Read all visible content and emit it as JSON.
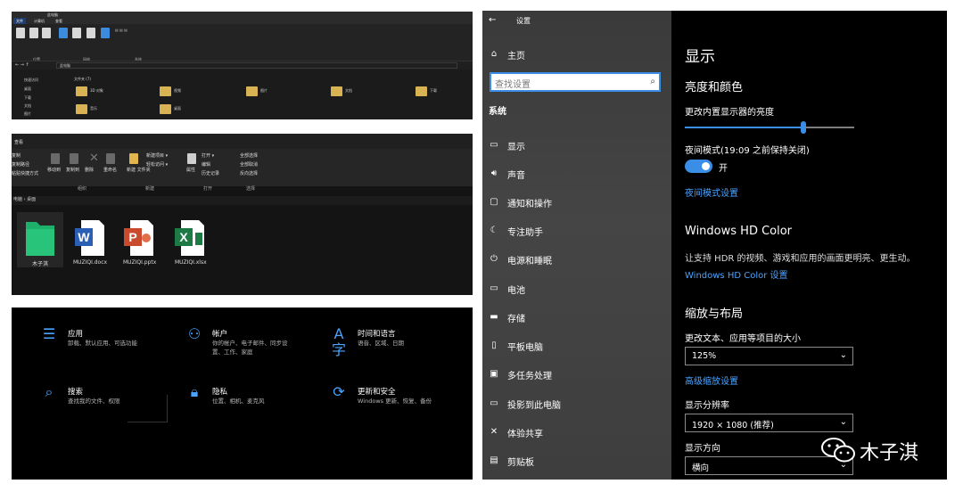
{
  "explorer_top": {
    "title": "此电脑",
    "tabs": [
      "文件",
      "计算机",
      "查看"
    ],
    "ribbon_group_labels": [
      "位置",
      "网络",
      "系统"
    ],
    "address": "此电脑",
    "nav_items": [
      "快速访问",
      "桌面",
      "下载",
      "文档",
      "图片"
    ],
    "folders_header": "文件夹 (7)",
    "folders": [
      "3D 对象",
      "视频",
      "图片",
      "文档",
      "下载",
      "音乐",
      "桌面"
    ]
  },
  "explorer_desktop": {
    "tab": "查看",
    "ribbon": {
      "left_items": [
        "复制",
        "复制路径",
        "粘贴快捷方式"
      ],
      "clipboard_buttons": [
        "移动到",
        "复制到",
        "删除",
        "重命名"
      ],
      "new_items": [
        "新建项目 ▾",
        "轻松访问 ▾"
      ],
      "new_folder": "新建\n文件夹",
      "open_items": [
        "打开 ▾",
        "编辑",
        "历史记录"
      ],
      "properties": "属性",
      "select_items": [
        "全部选择",
        "全部取消",
        "反向选择"
      ],
      "group_labels": [
        "组织",
        "新建",
        "打开",
        "选择"
      ]
    },
    "breadcrumb": "电脑 › 桌面",
    "files": [
      {
        "name": "木子淇",
        "type": "folder"
      },
      {
        "name": "MUZIQI.docx",
        "type": "word"
      },
      {
        "name": "MUZIQI.pptx",
        "type": "ppt"
      },
      {
        "name": "MUZIQI.xlsx",
        "type": "excel"
      }
    ]
  },
  "settings_home": {
    "items": [
      {
        "icon": "apps-icon",
        "title": "应用",
        "desc": [
          "卸载、默认应用、可选功能"
        ]
      },
      {
        "icon": "account-icon",
        "title": "帐户",
        "desc": [
          "你的帐户、电子邮件、同步设",
          "置、工作、家庭"
        ]
      },
      {
        "icon": "time-language-icon",
        "title": "时间和语言",
        "desc": [
          "语音、区域、日期"
        ]
      },
      {
        "icon": "search-icon",
        "title": "搜索",
        "desc": [
          "查找我的文件、权限"
        ]
      },
      {
        "icon": "privacy-lock-icon",
        "title": "隐私",
        "desc": [
          "位置、相机、麦克风"
        ]
      },
      {
        "icon": "update-security-icon",
        "title": "更新和安全",
        "desc": [
          "Windows 更新、恢复、备份"
        ]
      }
    ]
  },
  "settings_display": {
    "window_title": "设置",
    "home": "主页",
    "search_placeholder": "查找设置",
    "section": "系统",
    "nav_items": [
      {
        "icon": "display-icon",
        "label": "显示"
      },
      {
        "icon": "sound-icon",
        "label": "声音"
      },
      {
        "icon": "notifications-icon",
        "label": "通知和操作"
      },
      {
        "icon": "focus-assist-icon",
        "label": "专注助手"
      },
      {
        "icon": "power-icon",
        "label": "电源和睡眠"
      },
      {
        "icon": "battery-icon",
        "label": "电池"
      },
      {
        "icon": "storage-icon",
        "label": "存储"
      },
      {
        "icon": "tablet-icon",
        "label": "平板电脑"
      },
      {
        "icon": "multitasking-icon",
        "label": "多任务处理"
      },
      {
        "icon": "project-icon",
        "label": "投影到此电脑"
      },
      {
        "icon": "shared-icon",
        "label": "体验共享"
      },
      {
        "icon": "clipboard-icon",
        "label": "剪贴板"
      }
    ],
    "page_title": "显示",
    "brightness_heading": "亮度和颜色",
    "brightness_label": "更改内置显示器的亮度",
    "brightness_value": 0.7,
    "night_light_label": "夜间模式(19:09 之前保持关闭)",
    "night_light_state": "开",
    "night_light_link": "夜间模式设置",
    "hdr_heading": "Windows HD Color",
    "hdr_desc": "让支持 HDR 的视频、游戏和应用的画面更明亮、更生动。",
    "hdr_link": "Windows HD Color 设置",
    "scale_heading": "缩放与布局",
    "scale_label": "更改文本、应用等项目的大小",
    "scale_value": "125%",
    "scale_link": "高级缩放设置",
    "resolution_label": "显示分辨率",
    "resolution_value": "1920 × 1080 (推荐)",
    "orientation_label": "显示方向",
    "orientation_value": "横向"
  },
  "watermark": {
    "text": "木子淇",
    "icon": "wechat-icon"
  },
  "colors": {
    "accent": "#3a8ee6",
    "link": "#4aa3ff",
    "settings_bg": "#000000"
  }
}
